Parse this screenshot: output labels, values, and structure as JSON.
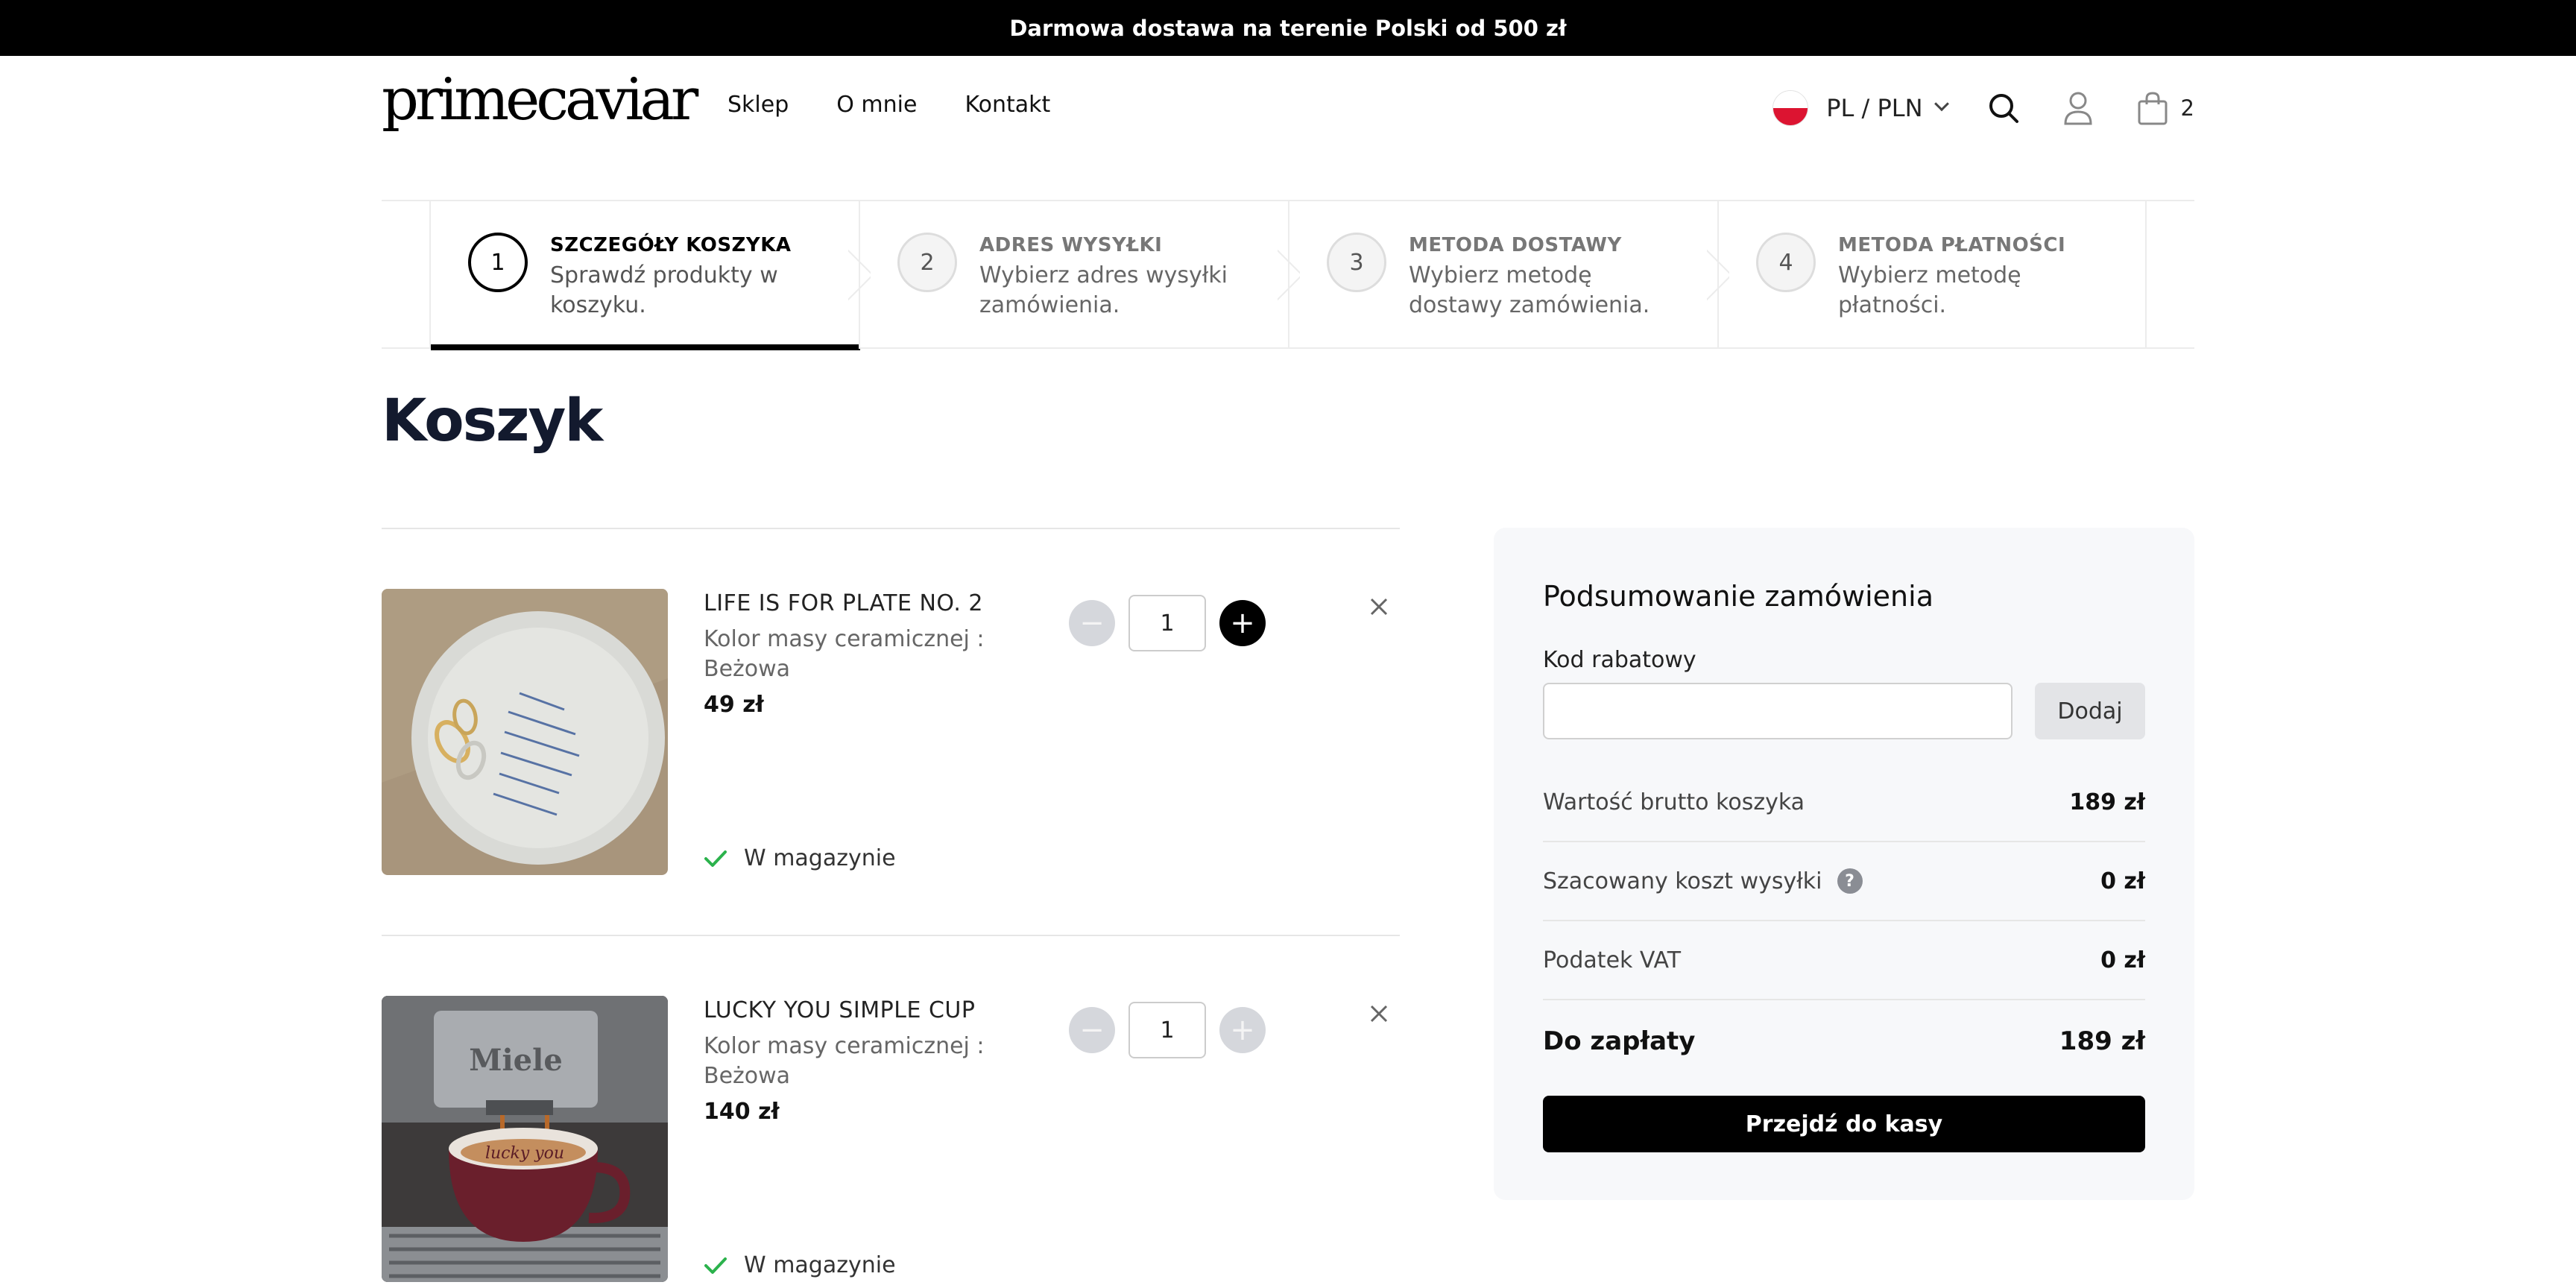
{
  "topbar": {
    "text": "Darmowa dostawa na terenie Polski od 500 zł"
  },
  "header": {
    "logo": "primecaviar",
    "nav": [
      "Sklep",
      "O mnie",
      "Kontakt"
    ],
    "locale": "PL / PLN",
    "cart_count": "2",
    "icons": [
      "poland-flag-icon",
      "chevron-down-icon",
      "search-icon",
      "user-icon",
      "shopping-bag-icon"
    ]
  },
  "steps": [
    {
      "num": "1",
      "title": "SZCZEGÓŁY KOSZYKA",
      "desc": "Sprawdź produkty w koszyku.",
      "active": true
    },
    {
      "num": "2",
      "title": "ADRES WYSYŁKI",
      "desc": "Wybierz adres wysyłki zamówienia.",
      "active": false
    },
    {
      "num": "3",
      "title": "METODA DOSTAWY",
      "desc": "Wybierz metodę dostawy zamówienia.",
      "active": false
    },
    {
      "num": "4",
      "title": "METODA PŁATNOŚCI",
      "desc": "Wybierz metodę płatności.",
      "active": false
    }
  ],
  "page_title": "Koszyk",
  "cart_items": [
    {
      "name": "LIFE IS FOR PLATE NO. 2",
      "attr": "Kolor masy ceramicznej : Beżowa",
      "price": "49 zł",
      "qty": "1",
      "stock": "W magazynie",
      "plus_enabled": true
    },
    {
      "name": "LUCKY YOU SIMPLE CUP",
      "attr": "Kolor masy ceramicznej : Beżowa",
      "price": "140 zł",
      "qty": "1",
      "stock": "W magazynie",
      "plus_enabled": false
    }
  ],
  "summary": {
    "title": "Podsumowanie zamówienia",
    "code_label": "Kod rabatowy",
    "code_value": "",
    "add_label": "Dodaj",
    "rows": [
      {
        "label": "Wartość brutto koszyka",
        "value": "189 zł"
      },
      {
        "label": "Szacowany koszt wysyłki",
        "value": "0 zł",
        "help": "?"
      },
      {
        "label": "Podatek VAT",
        "value": "0 zł"
      }
    ],
    "total_label": "Do zapłaty",
    "total_value": "189 zł",
    "checkout_label": "Przejdź do kasy"
  },
  "colors": {
    "accent": "#000000",
    "stock_check": "#2bb24c",
    "title": "#131a2e",
    "summary_bg": "#f7f8fa"
  }
}
